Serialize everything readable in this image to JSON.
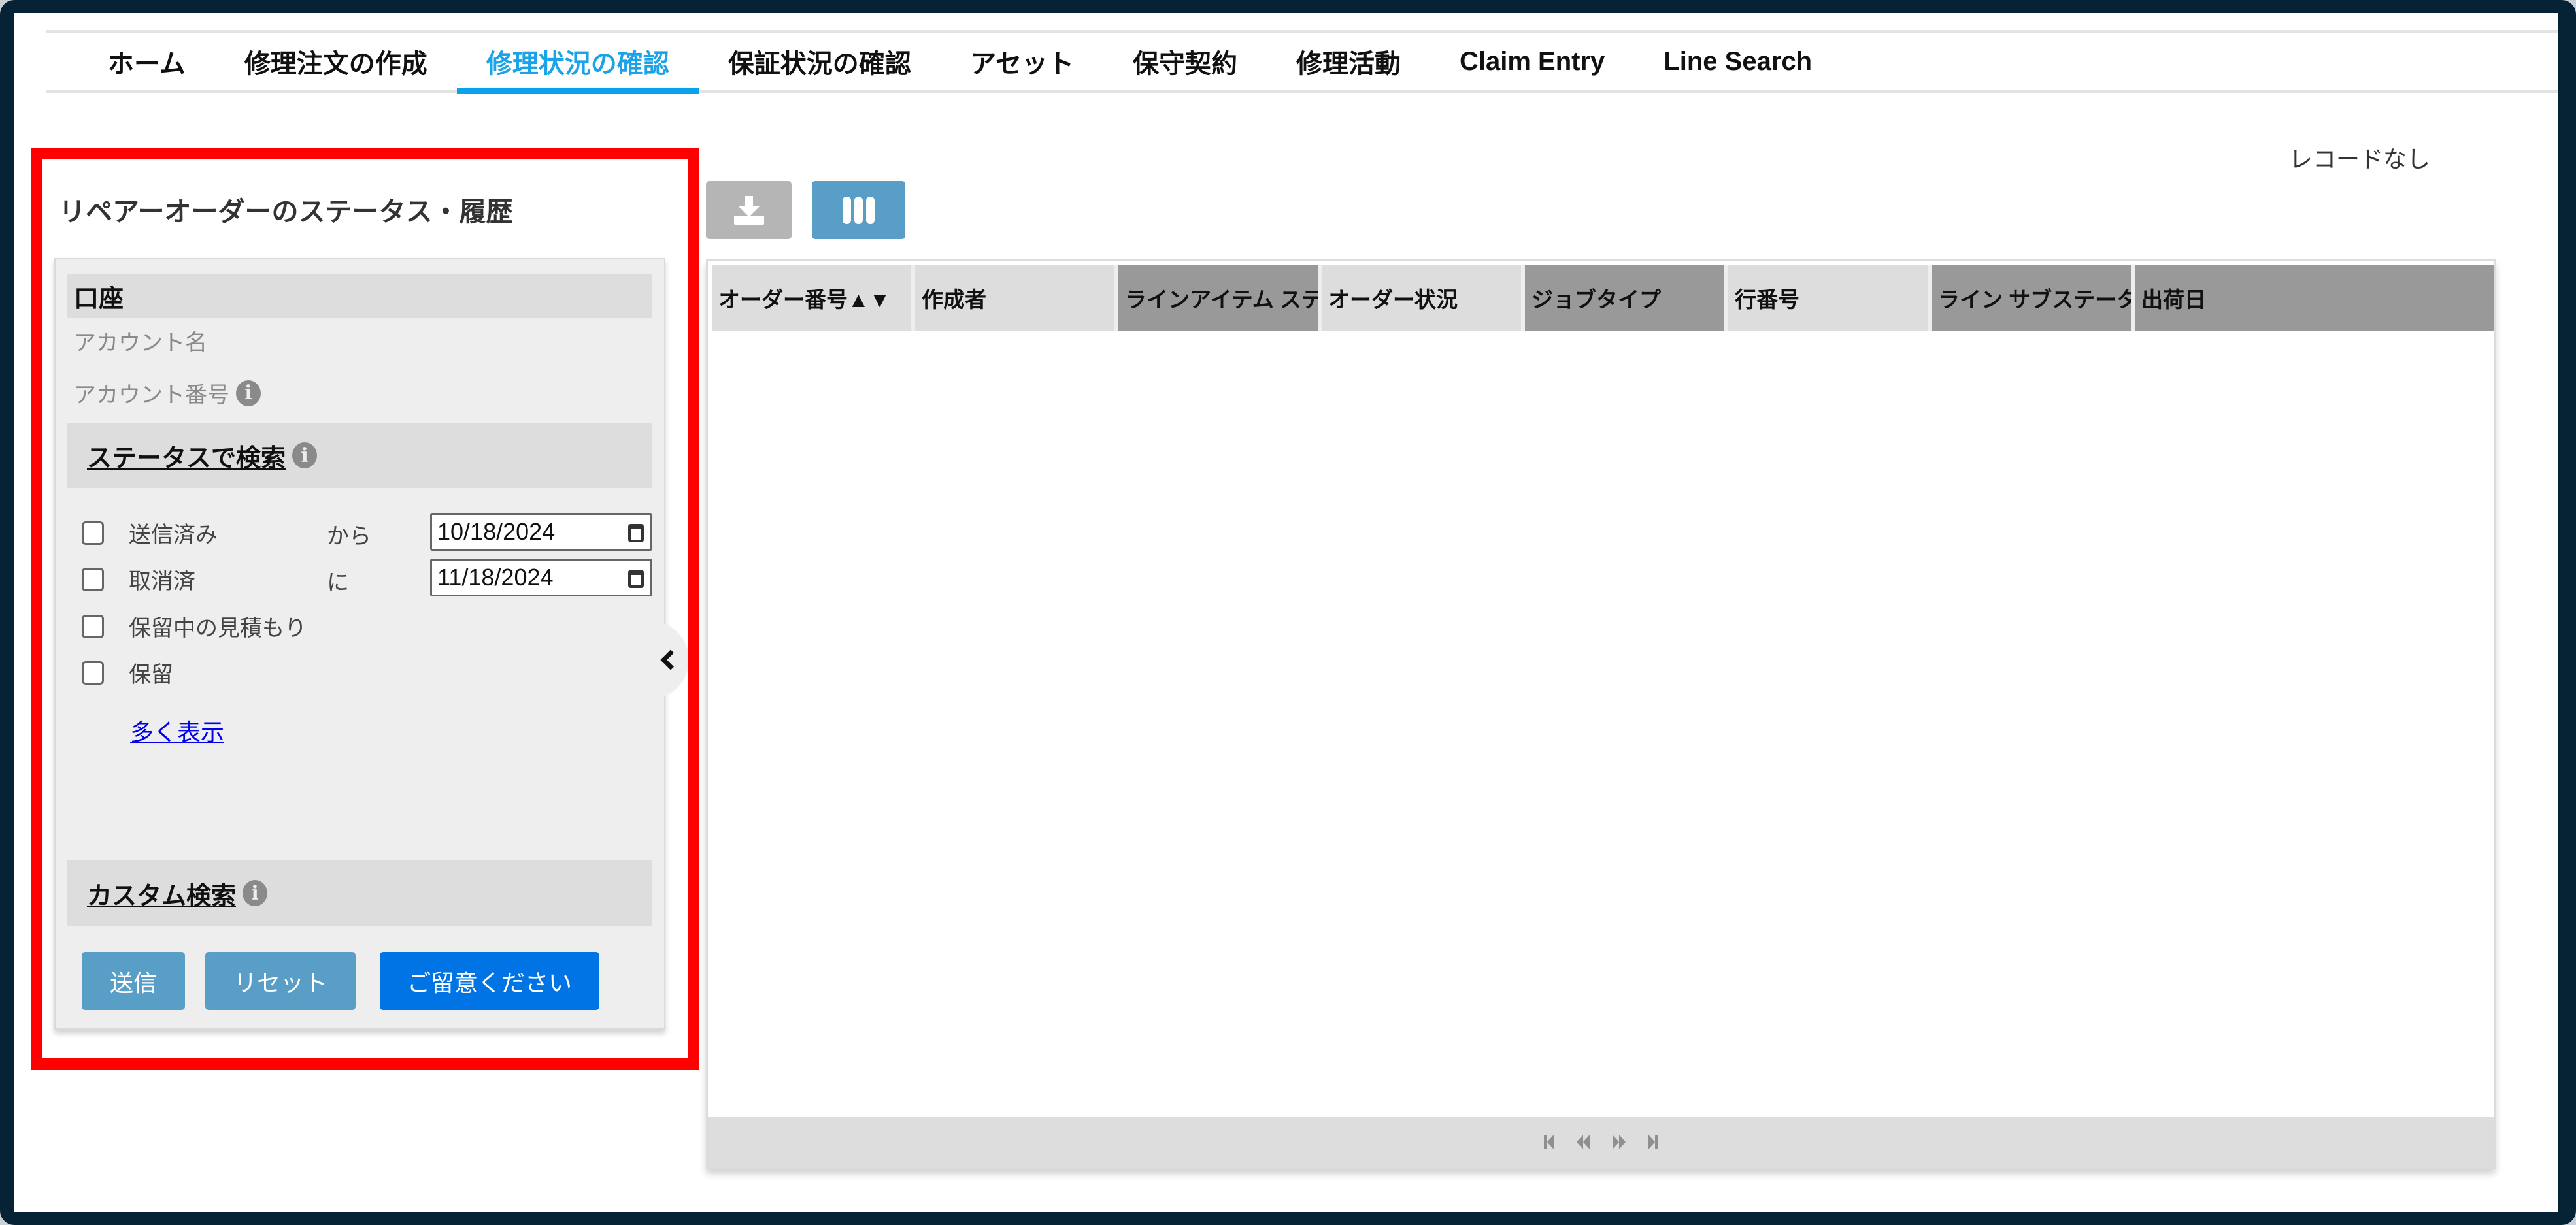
{
  "nav": {
    "tabs": [
      {
        "label": "ホーム",
        "active": false
      },
      {
        "label": "修理注文の作成",
        "active": false
      },
      {
        "label": "修理状況の確認",
        "active": true
      },
      {
        "label": "保証状況の確認",
        "active": false
      },
      {
        "label": "アセット",
        "active": false
      },
      {
        "label": "保守契約",
        "active": false
      },
      {
        "label": "修理活動",
        "active": false
      },
      {
        "label": "Claim Entry",
        "active": false
      },
      {
        "label": "Line Search",
        "active": false
      }
    ]
  },
  "panel": {
    "title": "リペアーオーダーのステータス・履歴",
    "account_section": "口座",
    "account_name_label": "アカウント名",
    "account_number_label": "アカウント番号",
    "status_section": "ステータスで検索",
    "statuses": [
      {
        "label": "送信済み",
        "checked": false
      },
      {
        "label": "取消済",
        "checked": false
      },
      {
        "label": "保留中の見積もり",
        "checked": false
      },
      {
        "label": "保留",
        "checked": false
      }
    ],
    "from_label": "から",
    "to_label": "に",
    "from_date": "10/18/2024",
    "to_date": "11/18/2024",
    "more_link": "多く表示",
    "custom_section": "カスタム検索",
    "buttons": {
      "submit": "送信",
      "reset": "リセット",
      "notice": "ご留意ください"
    }
  },
  "grid": {
    "records_status": "レコードなし",
    "columns": [
      {
        "label": "オーダー番号▲▼",
        "shade": "light"
      },
      {
        "label": "作成者",
        "shade": "light"
      },
      {
        "label": "ラインアイテム ステ",
        "shade": "dark"
      },
      {
        "label": "オーダー状況",
        "shade": "light"
      },
      {
        "label": "ジョブタイプ",
        "shade": "dark"
      },
      {
        "label": "行番号",
        "shade": "light"
      },
      {
        "label": "ライン サブステータ",
        "shade": "dark"
      },
      {
        "label": "出荷日",
        "shade": "dark"
      }
    ],
    "rows": []
  },
  "colors": {
    "frame": "#062235",
    "active_tab": "#1aa3e8",
    "highlight": "#ff0000",
    "button_secondary": "#589ec6",
    "button_primary": "#0074e4"
  }
}
